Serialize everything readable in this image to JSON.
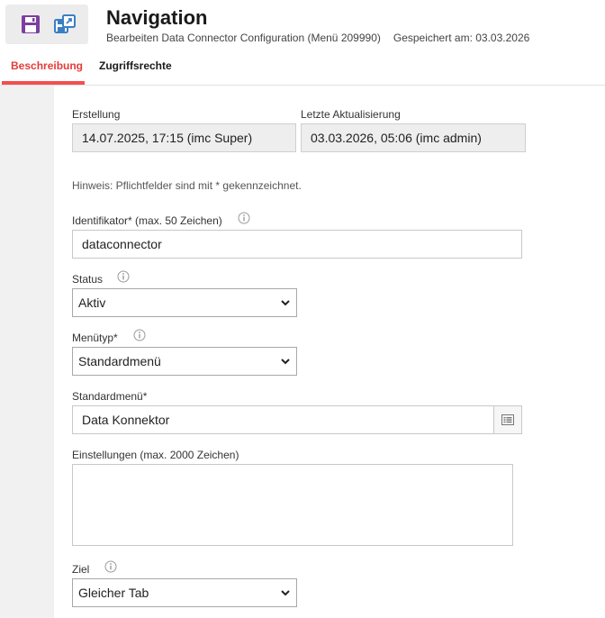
{
  "header": {
    "title": "Navigation",
    "subtitle": "Bearbeiten Data Connector Configuration (Menü 209990)",
    "saved_at": "Gespeichert am: 03.03.2026",
    "icons": [
      "save-icon",
      "save-as-icon"
    ]
  },
  "tabs": [
    {
      "label": "Beschreibung",
      "active": true
    },
    {
      "label": "Zugriffsrechte",
      "active": false
    }
  ],
  "meta": {
    "created_label": "Erstellung",
    "created_value": "14.07.2025, 17:15 (imc Super)",
    "updated_label": "Letzte Aktualisierung",
    "updated_value": "03.03.2026, 05:06 (imc admin)"
  },
  "hint": "Hinweis: Pflichtfelder sind mit * gekennzeichnet.",
  "fields": {
    "identifier": {
      "label": "Identifikator* (max. 50 Zeichen)",
      "value": "dataconnector"
    },
    "status": {
      "label": "Status",
      "value": "Aktiv"
    },
    "menu_type": {
      "label": "Menütyp*",
      "value": "Standardmenü"
    },
    "standard_menu": {
      "label": "Standardmenü*",
      "value": "Data Konnektor"
    },
    "settings": {
      "label": "Einstellungen (max. 2000 Zeichen)",
      "value": ""
    },
    "target": {
      "label": "Ziel",
      "value": "Gleicher Tab"
    }
  },
  "colors": {
    "accent": "#e63a3a",
    "save_icon": "#7b3fa0",
    "save_as_icon": "#3a7fc4"
  }
}
